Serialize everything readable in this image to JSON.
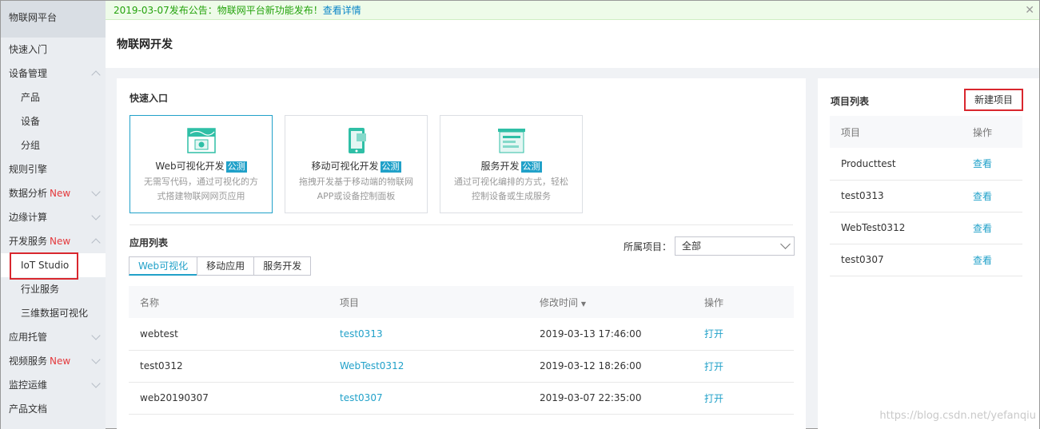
{
  "sidebar": {
    "brand": "物联网平台",
    "items": [
      {
        "label": "快速入门",
        "level": 1,
        "chevron": ""
      },
      {
        "label": "设备管理",
        "level": 1,
        "chevron": "up"
      },
      {
        "label": "产品",
        "level": 2,
        "chevron": ""
      },
      {
        "label": "设备",
        "level": 2,
        "chevron": ""
      },
      {
        "label": "分组",
        "level": 2,
        "chevron": ""
      },
      {
        "label": "规则引擎",
        "level": 1,
        "chevron": ""
      },
      {
        "label": "数据分析",
        "new": "New",
        "level": 1,
        "chevron": "down"
      },
      {
        "label": "边缘计算",
        "level": 1,
        "chevron": "down"
      },
      {
        "label": "开发服务",
        "new": "New",
        "level": 1,
        "chevron": "up"
      },
      {
        "label": "IoT Studio",
        "level": 2,
        "chevron": "",
        "active": true
      },
      {
        "label": "行业服务",
        "level": 2,
        "chevron": ""
      },
      {
        "label": "三维数据可视化",
        "level": 2,
        "chevron": ""
      },
      {
        "label": "应用托管",
        "level": 1,
        "chevron": "down"
      },
      {
        "label": "视频服务",
        "new": "New",
        "level": 1,
        "chevron": "down"
      },
      {
        "label": "监控运维",
        "level": 1,
        "chevron": "down"
      },
      {
        "label": "产品文档",
        "level": 1,
        "chevron": ""
      }
    ]
  },
  "notice": {
    "text": "2019-03-07发布公告：物联网平台新功能发布！",
    "link": "查看详情",
    "close": "✕"
  },
  "page_title": "物联网开发",
  "quick_entry": {
    "title": "快速入口",
    "cards": [
      {
        "title": "Web可视化开发",
        "badge": "公测",
        "desc": "无需写代码，通过可视化的方式搭建物联网网页应用"
      },
      {
        "title": "移动可视化开发",
        "badge": "公测",
        "desc": "拖拽开发基于移动端的物联网APP或设备控制面板"
      },
      {
        "title": "服务开发",
        "badge": "公测",
        "desc": "通过可视化编排的方式，轻松控制设备或生成服务"
      }
    ]
  },
  "app_list": {
    "title": "应用列表",
    "filter_label": "所属项目：",
    "filter_value": "全部",
    "tabs": [
      "Web可视化",
      "移动应用",
      "服务开发"
    ],
    "columns": [
      "名称",
      "项目",
      "修改时间",
      "操作"
    ],
    "sort_glyph": "▼",
    "rows": [
      {
        "name": "webtest",
        "project": "test0313",
        "time": "2019-03-13 17:46:00",
        "action": "打开"
      },
      {
        "name": "test0312",
        "project": "WebTest0312",
        "time": "2019-03-12 18:26:00",
        "action": "打开"
      },
      {
        "name": "web20190307",
        "project": "test0307",
        "time": "2019-03-07 22:35:00",
        "action": "打开"
      }
    ]
  },
  "projects": {
    "title": "项目列表",
    "new_button": "新建项目",
    "columns": [
      "项目",
      "操作"
    ],
    "rows": [
      {
        "name": "Producttest",
        "action": "查看"
      },
      {
        "name": "test0313",
        "action": "查看"
      },
      {
        "name": "WebTest0312",
        "action": "查看"
      },
      {
        "name": "test0307",
        "action": "查看"
      }
    ]
  },
  "watermark": "https://blog.csdn.net/yefanqiu",
  "colors": {
    "accent": "#21a1c9",
    "new": "#e4393c",
    "highlight_box": "#d9272e",
    "notice": "#24a30c"
  }
}
